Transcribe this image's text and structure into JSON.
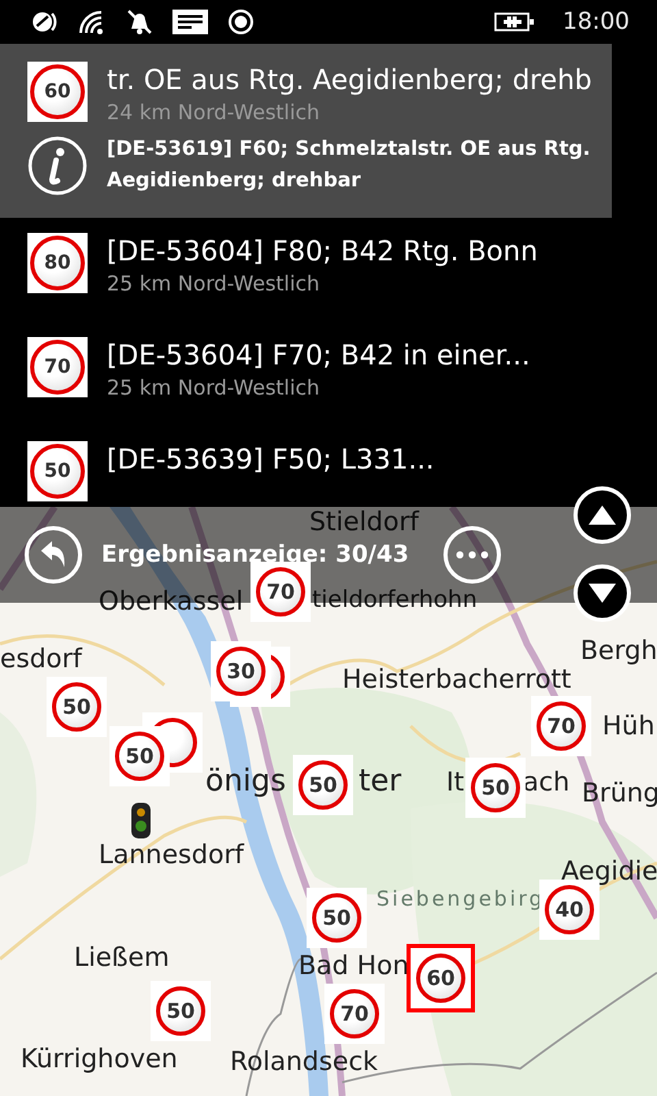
{
  "status_bar": {
    "time": "18:00"
  },
  "results": [
    {
      "speed": "60",
      "title": "tr. OE aus Rtg. Aegidienberg; drehb",
      "distance": "24 km Nord-Westlich",
      "detail": "[DE-53619] F60; Schmelztalstr. OE aus Rtg. Aegidienberg; drehbar",
      "selected": true
    },
    {
      "speed": "80",
      "title": "[DE-53604] F80; B42 Rtg. Bonn",
      "distance": "25 km Nord-Westlich",
      "selected": false
    },
    {
      "speed": "70",
      "title": "[DE-53604] F70; B42 in einer...",
      "distance": "25 km Nord-Westlich",
      "selected": false
    },
    {
      "speed": "50",
      "title": "[DE-53639] F50; L331...",
      "selected": false
    }
  ],
  "result_bar": {
    "label": "Ergebnisanzeige: 30/43"
  },
  "map": {
    "labels": [
      {
        "text": "Stieldorf",
        "kind": "town"
      },
      {
        "text": "tieldorferhohn",
        "kind": "town"
      },
      {
        "text": "Oberkassel",
        "kind": "town"
      },
      {
        "text": "Bergh",
        "kind": "town"
      },
      {
        "text": "esdorf",
        "kind": "town"
      },
      {
        "text": "Heisterbacherrott",
        "kind": "town"
      },
      {
        "text": "Hüh",
        "kind": "town"
      },
      {
        "text": "önigs",
        "kind": "city"
      },
      {
        "text": "ter",
        "kind": "city"
      },
      {
        "text": "It",
        "kind": "town"
      },
      {
        "text": "ach",
        "kind": "town"
      },
      {
        "text": "Brüng",
        "kind": "town"
      },
      {
        "text": "Lannesdorf",
        "kind": "town"
      },
      {
        "text": "Aegidie",
        "kind": "town"
      },
      {
        "text": "Siebengebirg",
        "kind": "region"
      },
      {
        "text": "Ließem",
        "kind": "town"
      },
      {
        "text": "Bad Hon",
        "kind": "town"
      },
      {
        "text": "Kürrighoven",
        "kind": "town"
      },
      {
        "text": "Rolandseck",
        "kind": "town"
      }
    ],
    "markers": [
      {
        "speed": "70",
        "kind": "single",
        "selected": false
      },
      {
        "speed": "30",
        "kind": "pair",
        "selected": false
      },
      {
        "speed": "50",
        "kind": "single",
        "selected": false
      },
      {
        "speed": "50",
        "kind": "stack",
        "selected": false
      },
      {
        "speed": "50",
        "kind": "single",
        "selected": false
      },
      {
        "speed": "70",
        "kind": "single",
        "selected": false
      },
      {
        "speed": "50",
        "kind": "single",
        "selected": false
      },
      {
        "speed": "50",
        "kind": "single",
        "selected": false
      },
      {
        "speed": "40",
        "kind": "single",
        "selected": false
      },
      {
        "speed": "60",
        "kind": "single",
        "selected": true
      },
      {
        "speed": "50",
        "kind": "single",
        "selected": false
      },
      {
        "speed": "70",
        "kind": "single",
        "selected": false
      }
    ]
  }
}
